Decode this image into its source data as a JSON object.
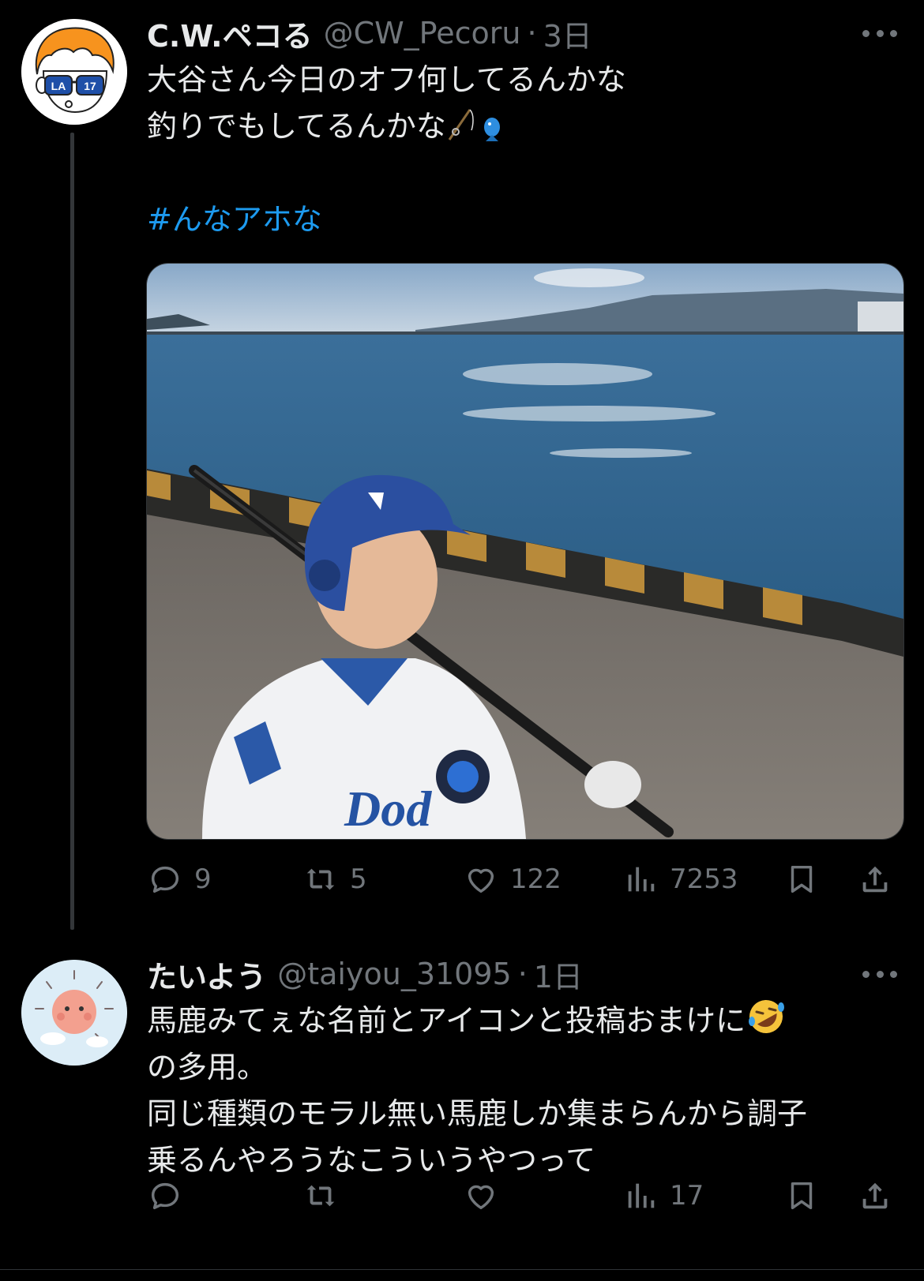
{
  "tweet1": {
    "display_name": "C.W.ペコる",
    "handle": "@CW_Pecoru",
    "separator": "·",
    "time": "3日",
    "text_line1": "大谷さん今日のオフ何してるんかな",
    "text_line2": "釣りでもしてるんかな",
    "hashtag": "#んなアホな",
    "avatar_badge_left": "LA",
    "avatar_badge_right": "17",
    "actions": {
      "reply_count": "9",
      "retweet_count": "5",
      "like_count": "122",
      "view_count": "7253"
    },
    "icons": [
      "fishing-pole-icon",
      "fish-icon",
      "reply-icon",
      "retweet-icon",
      "like-icon",
      "views-icon",
      "bookmark-icon",
      "share-icon",
      "more-icon"
    ]
  },
  "tweet2": {
    "display_name": "たいよう",
    "handle": "@taiyou_31095",
    "separator": "·",
    "time": "1日",
    "text_line1": "馬鹿みてぇな名前とアイコンと投稿おまけに",
    "text_line2": "の多用。",
    "text_line3": "同じ種類のモラル無い馬鹿しか集まらんから調子",
    "text_line4": "乗るんやろうなこういうやつって",
    "actions": {
      "reply_count": "",
      "retweet_count": "",
      "like_count": "",
      "view_count": "17"
    },
    "icons": [
      "rolling-laughing-emoji-icon",
      "reply-icon",
      "retweet-icon",
      "like-icon",
      "views-icon",
      "bookmark-icon",
      "share-icon",
      "more-icon"
    ]
  },
  "colors": {
    "background": "#000000",
    "text": "#e7e9ea",
    "secondary": "#71767b",
    "link": "#1d9bf0"
  }
}
